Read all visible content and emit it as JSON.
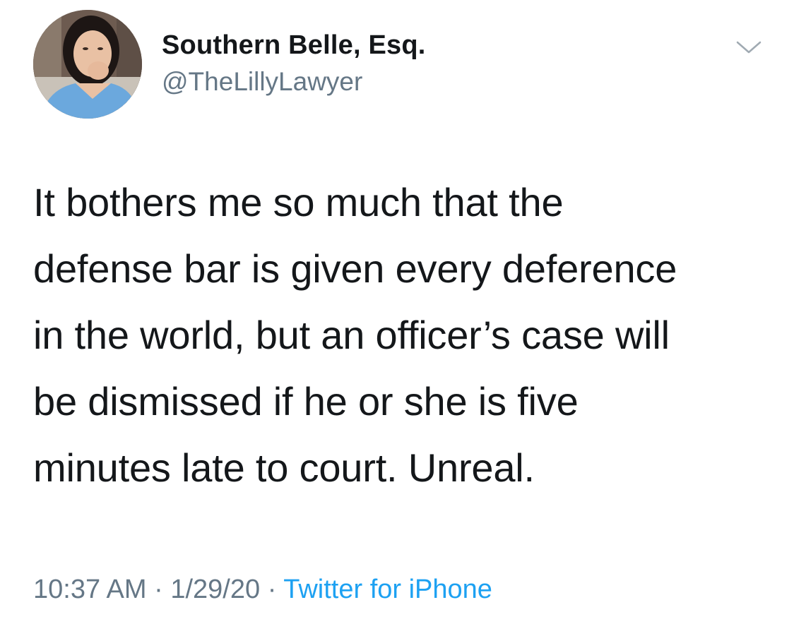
{
  "author": {
    "display_name": "Southern Belle, Esq.",
    "handle": "@TheLillyLawyer"
  },
  "menu": {
    "icon": "chevron-down-icon"
  },
  "tweet": {
    "text": "It bothers me so much that the\ndefense bar is given every deference\nin the world, but an officer’s case will\nbe dismissed if he or she is five\nminutes late to court. Unreal."
  },
  "meta": {
    "time": "10:37 AM",
    "separator": "·",
    "date": "1/29/20",
    "source": "Twitter for iPhone"
  },
  "colors": {
    "text": "#14171a",
    "secondary": "#657786",
    "link": "#1da1f2"
  }
}
